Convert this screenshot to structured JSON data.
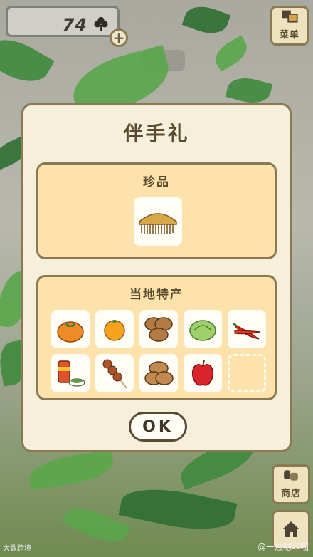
{
  "top_bar": {
    "coins": "74",
    "coin_icon": "clover-icon",
    "add_icon": "plus-icon",
    "add_label": "+"
  },
  "side_buttons": {
    "menu_label": "菜单",
    "shop_label": "商店",
    "home_icon": "house-icon"
  },
  "dialog": {
    "title": "伴手礼",
    "rare_section": {
      "title": "珍品",
      "items": [
        {
          "icon": "comb-icon"
        }
      ]
    },
    "local_section": {
      "title": "当地特产",
      "items": [
        {
          "icon": "persimmon-icon"
        },
        {
          "icon": "orange-icon"
        },
        {
          "icon": "buns-icon"
        },
        {
          "icon": "cabbage-icon"
        },
        {
          "icon": "chili-pepper-icon"
        },
        {
          "icon": "can-and-snack-icon"
        },
        {
          "icon": "dango-skewer-icon"
        },
        {
          "icon": "bread-rolls-icon"
        },
        {
          "icon": "apple-icon"
        },
        {
          "icon": "empty-slot"
        }
      ]
    },
    "ok_label": "OK"
  },
  "watermarks": {
    "left": "大数跨境",
    "right": "@一烛嗯菲喵"
  },
  "colors": {
    "panel": "#fde2ab",
    "dialog": "#f6efdb",
    "border": "#8a7a53"
  }
}
